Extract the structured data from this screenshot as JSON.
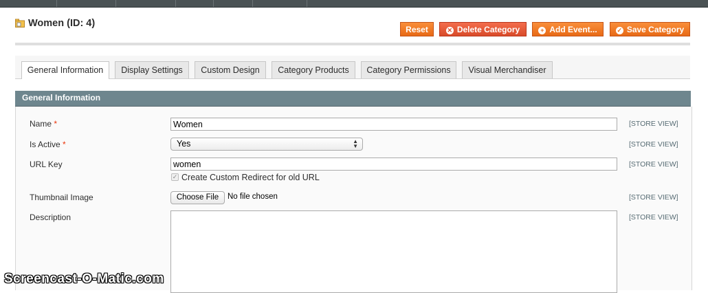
{
  "page": {
    "title": "Women (ID: 4)"
  },
  "actions": {
    "reset": "Reset",
    "delete": "Delete Category",
    "add_event": "Add Event...",
    "save": "Save Category"
  },
  "tabs": [
    {
      "label": "General Information",
      "active": true
    },
    {
      "label": "Display Settings",
      "active": false
    },
    {
      "label": "Custom Design",
      "active": false
    },
    {
      "label": "Category Products",
      "active": false
    },
    {
      "label": "Category Permissions",
      "active": false
    },
    {
      "label": "Visual Merchandiser",
      "active": false
    }
  ],
  "section": {
    "title": "General Information"
  },
  "form": {
    "name": {
      "label": "Name",
      "required_mark": "*",
      "value": "Women",
      "scope": "[STORE VIEW]"
    },
    "is_active": {
      "label": "Is Active",
      "required_mark": "*",
      "value": "Yes",
      "scope": "[STORE VIEW]"
    },
    "url_key": {
      "label": "URL Key",
      "value": "women",
      "scope": "[STORE VIEW]",
      "redirect_label": "Create Custom Redirect for old URL",
      "redirect_checked": true
    },
    "thumbnail": {
      "label": "Thumbnail Image",
      "button": "Choose File",
      "status": "No file chosen",
      "scope": "[STORE VIEW]"
    },
    "description": {
      "label": "Description",
      "value": "",
      "scope": "[STORE VIEW]"
    }
  },
  "watermark": "Screencast-O-Matic.com",
  "colors": {
    "accent_orange": "#e86a16",
    "delete_red": "#d94b2a",
    "section_header": "#6e868e",
    "required": "#eb340a"
  }
}
